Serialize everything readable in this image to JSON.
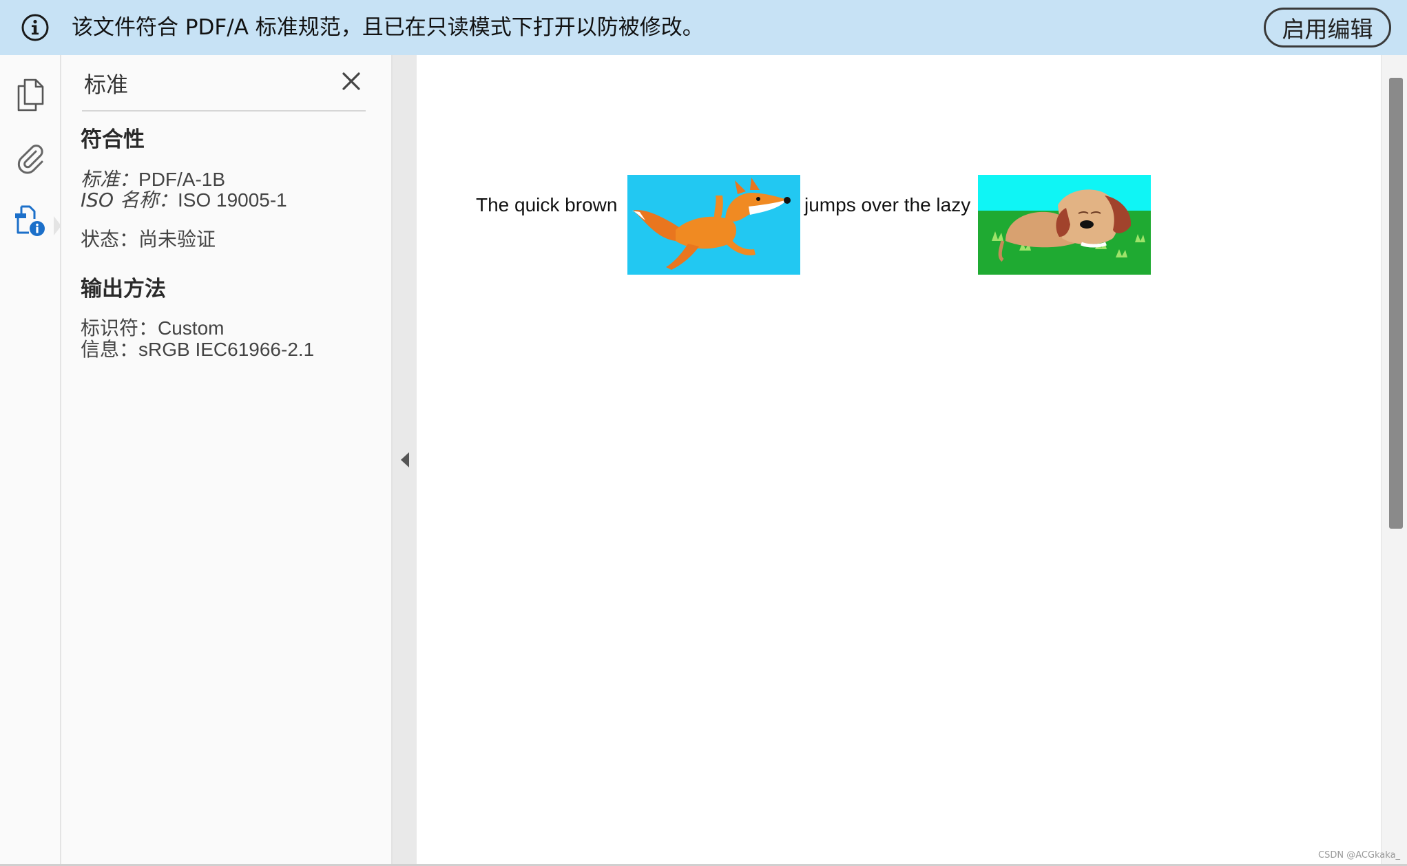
{
  "infobar": {
    "icon": "info-icon",
    "message": "该文件符合 PDF/A 标准规范，且已在只读模式下打开以防被修改。",
    "enable_edit_label": "启用编辑",
    "background": "#c7e2f5"
  },
  "rail": {
    "items": [
      {
        "icon": "pages-icon",
        "name": "页面缩略图"
      },
      {
        "icon": "attachment-icon",
        "name": "附件"
      },
      {
        "icon": "standards-info-icon",
        "name": "标准",
        "active": true
      }
    ],
    "active_color": "#1b6fc9"
  },
  "panel": {
    "title": "标准",
    "close_icon": "close-icon",
    "conformance": {
      "heading": "符合性",
      "standard_label": "标准：",
      "standard_value": "PDF/A-1B",
      "iso_label": "ISO 名称：",
      "iso_value": "ISO 19005-1",
      "status_label": "状态：",
      "status_value": "尚未验证"
    },
    "output_intent": {
      "heading": "输出方法",
      "identifier_label": "标识符：",
      "identifier_value": "Custom",
      "info_label": "信息：",
      "info_value": "sRGB IEC61966-2.1"
    }
  },
  "document": {
    "text_before": "The quick brown",
    "image1": "fox-running-image",
    "text_middle": "jumps over the lazy",
    "image2": "sleeping-dog-image"
  },
  "watermark": "CSDN @ACGkaka_"
}
